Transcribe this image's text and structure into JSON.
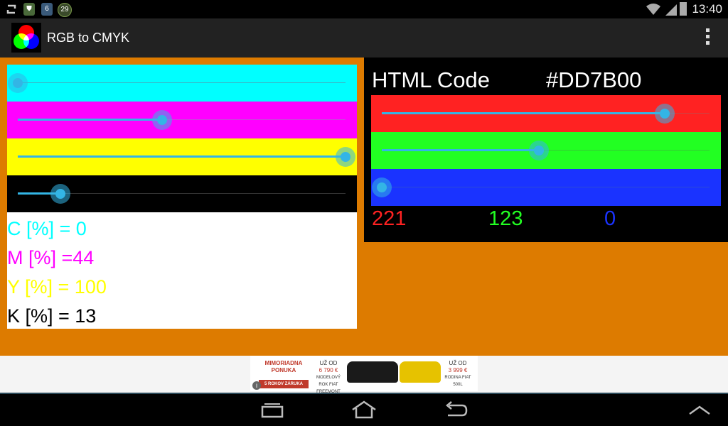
{
  "status_bar": {
    "time": "13:40",
    "notification_badge": "29",
    "icons": [
      "sync-icon",
      "shield-icon",
      "shield-6-icon",
      "badge-29-icon",
      "wifi-icon",
      "signal-icon",
      "battery-icon"
    ]
  },
  "app": {
    "title": "RGB to CMYK",
    "menu_icon": "overflow-menu-icon"
  },
  "colors": {
    "background": "#DD7B00",
    "cyan": "#00FFFF",
    "magenta": "#FF00FF",
    "yellow": "#FFFF00",
    "black": "#000000",
    "red": "#FF2222",
    "green": "#22FF22",
    "blue": "#1A33FF",
    "slider_accent": "#33B5E5"
  },
  "cmyk": {
    "sliders": [
      {
        "name": "cyan",
        "value": 0
      },
      {
        "name": "magenta",
        "value": 44
      },
      {
        "name": "yellow",
        "value": 100
      },
      {
        "name": "black",
        "value": 13
      }
    ],
    "labels": {
      "c": "C [%] = 0",
      "m": "M [%] =44",
      "y": "Y [%] = 100",
      "k": "K [%] = 13"
    }
  },
  "rgb": {
    "html_code_label": "HTML Code",
    "html_code_value": "#DD7B00",
    "sliders": [
      {
        "name": "red",
        "value": 221,
        "max": 255
      },
      {
        "name": "green",
        "value": 123,
        "max": 255
      },
      {
        "name": "blue",
        "value": 0,
        "max": 255
      }
    ],
    "values": {
      "r": "221",
      "g": "123",
      "b": "0"
    }
  },
  "ad": {
    "left_title": "MIMORIADNA PONUKA",
    "left_badge": "5 ROKOV ZÁRUKA",
    "mid_from": "UŽ OD",
    "mid_price": "6 790 €",
    "mid_model": "MODELOVÝ ROK FIAT FREEMONT",
    "right_from": "UŽ OD",
    "right_price": "3 999 €",
    "right_model": "RODINA FIAT 500L",
    "info_icon": "info-icon"
  },
  "nav": {
    "buttons": [
      "recent-apps-icon",
      "home-icon",
      "back-icon",
      "chevron-up-icon"
    ]
  }
}
